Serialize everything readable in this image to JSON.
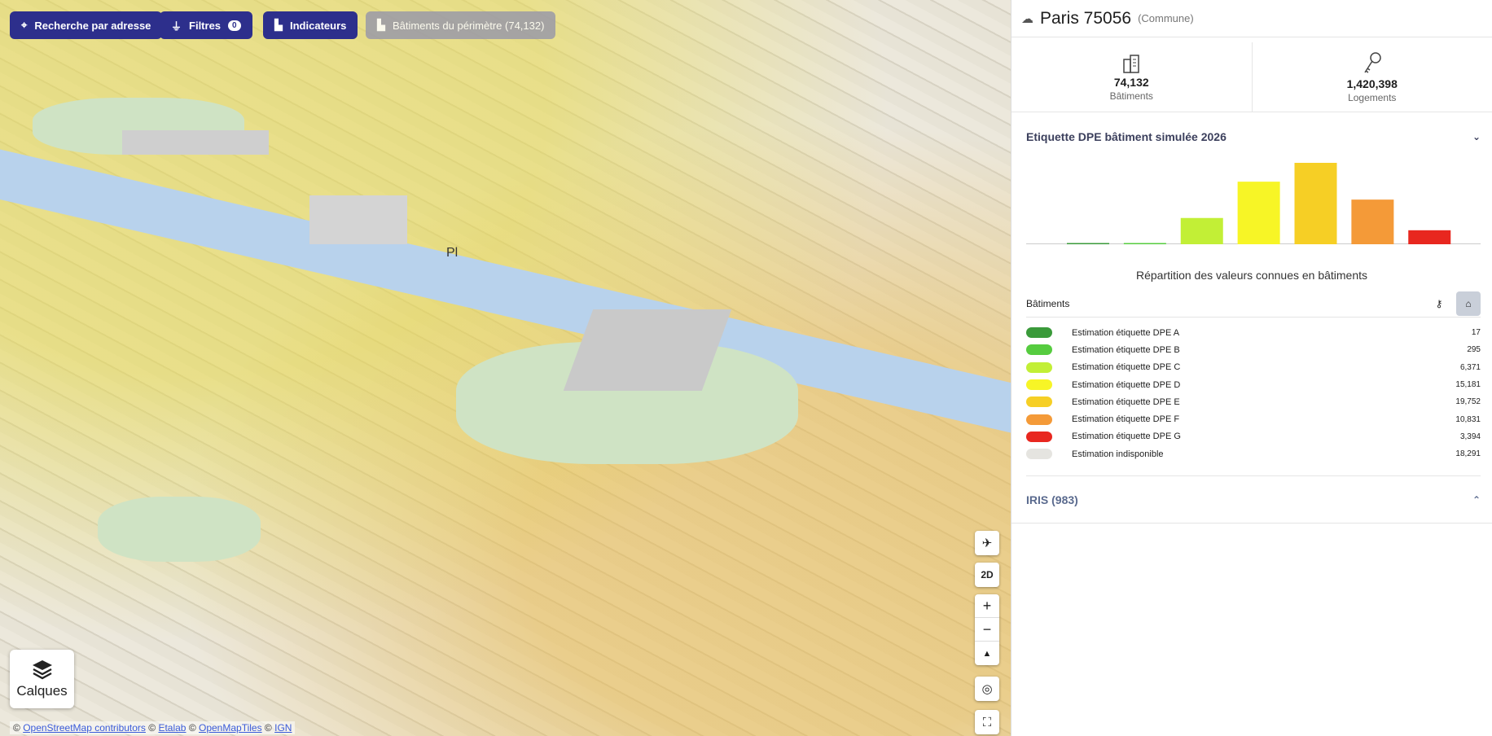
{
  "toolbar": {
    "search_label": "Recherche par adresse",
    "filters_label": "Filtres",
    "filters_count": "0",
    "indicators_label": "Indicateurs",
    "perimeter_label": "Bâtiments du périmètre (74,132)"
  },
  "map": {
    "layers_label": "Calques",
    "view_mode_label": "2D",
    "zoom_in": "+",
    "zoom_out": "−",
    "place_label": "Pl",
    "attribution": {
      "osm": "OpenStreetMap contributors",
      "etalab": "Etalab",
      "omt": "OpenMapTiles",
      "ign": "IGN"
    }
  },
  "panel": {
    "commune_name": "Paris 75056",
    "commune_type": "(Commune)",
    "stats": [
      {
        "value": "74,132",
        "label": "Bâtiments"
      },
      {
        "value": "1,420,398",
        "label": "Logements"
      }
    ],
    "dpe_section_title": "Etiquette DPE bâtiment simulée 2026",
    "chart_caption": "Répartition des valeurs connues en bâtiments",
    "legend_header": "Bâtiments",
    "legend": [
      {
        "label": "Estimation étiquette DPE A",
        "value": "17",
        "color": "#3a9a3a"
      },
      {
        "label": "Estimation étiquette DPE B",
        "value": "295",
        "color": "#56cc3f"
      },
      {
        "label": "Estimation étiquette DPE C",
        "value": "6,371",
        "color": "#c2ef36"
      },
      {
        "label": "Estimation étiquette DPE D",
        "value": "15,181",
        "color": "#f7f526"
      },
      {
        "label": "Estimation étiquette DPE E",
        "value": "19,752",
        "color": "#f6cf25"
      },
      {
        "label": "Estimation étiquette DPE F",
        "value": "10,831",
        "color": "#f49a38"
      },
      {
        "label": "Estimation étiquette DPE G",
        "value": "3,394",
        "color": "#e8271f"
      },
      {
        "label": "Estimation indisponible",
        "value": "18,291",
        "color": "#e5e4e0"
      }
    ],
    "iris_title": "IRIS (983)"
  },
  "chart_data": {
    "type": "bar",
    "categories": [
      "A",
      "B",
      "C",
      "D",
      "E",
      "F",
      "G"
    ],
    "values": [
      17,
      295,
      6371,
      15181,
      19752,
      10831,
      3394
    ],
    "colors": [
      "#3a9a3a",
      "#56cc3f",
      "#c2ef36",
      "#f7f526",
      "#f6cf25",
      "#f49a38",
      "#e8271f"
    ],
    "title": "",
    "xlabel": "",
    "ylabel": "",
    "ylim": [
      0,
      19752
    ]
  }
}
